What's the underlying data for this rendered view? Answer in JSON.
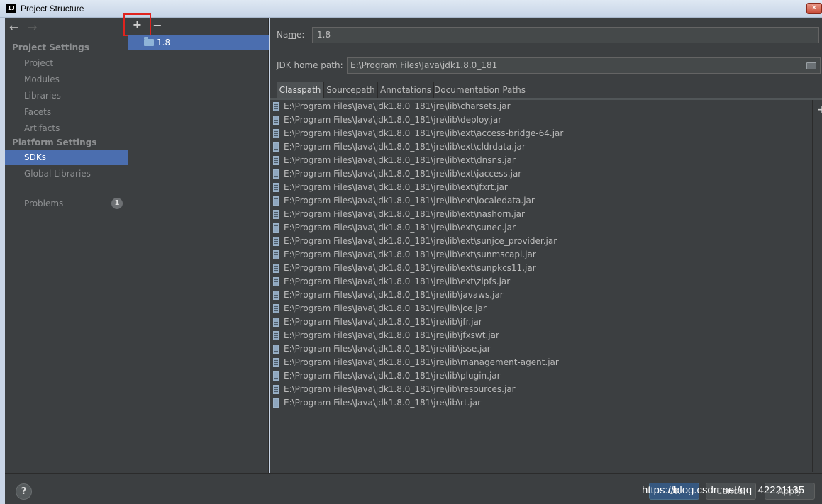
{
  "window": {
    "title": "Project Structure",
    "app_icon_text": "IJ",
    "close_glyph": "✕"
  },
  "nav": {
    "back_glyph": "←",
    "forward_glyph": "→"
  },
  "sidebar": {
    "project_settings_header": "Project Settings",
    "project_settings_items": [
      "Project",
      "Modules",
      "Libraries",
      "Facets",
      "Artifacts"
    ],
    "platform_settings_header": "Platform Settings",
    "platform_settings_items": [
      "SDKs",
      "Global Libraries"
    ],
    "selected_item": "SDKs",
    "problems_label": "Problems",
    "problems_count": "1"
  },
  "sdk_list": {
    "add_glyph": "+",
    "remove_glyph": "−",
    "items": [
      "1.8"
    ]
  },
  "sdk_detail": {
    "name_label_prefix": "Na",
    "name_label_mnemonic": "m",
    "name_label_suffix": "e:",
    "name_value": "1.8",
    "jdk_home_label": "JDK home path:",
    "jdk_home_value": "E:\\Program Files\\Java\\jdk1.8.0_181",
    "tabs": [
      "Classpath",
      "Sourcepath",
      "Annotations",
      "Documentation Paths"
    ],
    "active_tab": "Classpath",
    "classpath_entries": [
      "E:\\Program Files\\Java\\jdk1.8.0_181\\jre\\lib\\charsets.jar",
      "E:\\Program Files\\Java\\jdk1.8.0_181\\jre\\lib\\deploy.jar",
      "E:\\Program Files\\Java\\jdk1.8.0_181\\jre\\lib\\ext\\access-bridge-64.jar",
      "E:\\Program Files\\Java\\jdk1.8.0_181\\jre\\lib\\ext\\cldrdata.jar",
      "E:\\Program Files\\Java\\jdk1.8.0_181\\jre\\lib\\ext\\dnsns.jar",
      "E:\\Program Files\\Java\\jdk1.8.0_181\\jre\\lib\\ext\\jaccess.jar",
      "E:\\Program Files\\Java\\jdk1.8.0_181\\jre\\lib\\ext\\jfxrt.jar",
      "E:\\Program Files\\Java\\jdk1.8.0_181\\jre\\lib\\ext\\localedata.jar",
      "E:\\Program Files\\Java\\jdk1.8.0_181\\jre\\lib\\ext\\nashorn.jar",
      "E:\\Program Files\\Java\\jdk1.8.0_181\\jre\\lib\\ext\\sunec.jar",
      "E:\\Program Files\\Java\\jdk1.8.0_181\\jre\\lib\\ext\\sunjce_provider.jar",
      "E:\\Program Files\\Java\\jdk1.8.0_181\\jre\\lib\\ext\\sunmscapi.jar",
      "E:\\Program Files\\Java\\jdk1.8.0_181\\jre\\lib\\ext\\sunpkcs11.jar",
      "E:\\Program Files\\Java\\jdk1.8.0_181\\jre\\lib\\ext\\zipfs.jar",
      "E:\\Program Files\\Java\\jdk1.8.0_181\\jre\\lib\\javaws.jar",
      "E:\\Program Files\\Java\\jdk1.8.0_181\\jre\\lib\\jce.jar",
      "E:\\Program Files\\Java\\jdk1.8.0_181\\jre\\lib\\jfr.jar",
      "E:\\Program Files\\Java\\jdk1.8.0_181\\jre\\lib\\jfxswt.jar",
      "E:\\Program Files\\Java\\jdk1.8.0_181\\jre\\lib\\jsse.jar",
      "E:\\Program Files\\Java\\jdk1.8.0_181\\jre\\lib\\management-agent.jar",
      "E:\\Program Files\\Java\\jdk1.8.0_181\\jre\\lib\\plugin.jar",
      "E:\\Program Files\\Java\\jdk1.8.0_181\\jre\\lib\\resources.jar",
      "E:\\Program Files\\Java\\jdk1.8.0_181\\jre\\lib\\rt.jar"
    ],
    "list_add_glyph": "+"
  },
  "footer": {
    "help_glyph": "?",
    "ok_label": "OK",
    "cancel_label": "Cancel",
    "apply_label": "Apply",
    "watermark": "https://blog.csdn.net/qq_42221135"
  },
  "colors": {
    "background": "#3c3f41",
    "selection": "#4b6eaf",
    "highlight_box": "#e0231e"
  }
}
